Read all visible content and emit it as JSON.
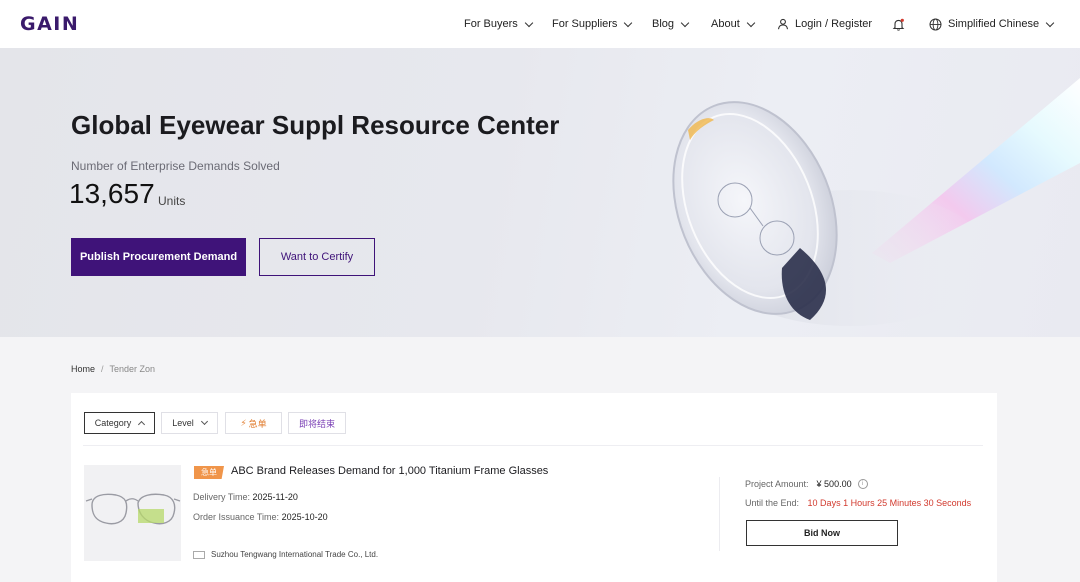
{
  "header": {
    "logo": "GAIN",
    "nav": {
      "for_buyers": "For Buyers",
      "for_suppliers": "For Suppliers",
      "blog": "Blog",
      "about": "About",
      "login": "Login / Register",
      "language": "Simplified Chinese"
    },
    "icons": [
      "chevron-down-icon",
      "user-icon",
      "bell-icon",
      "globe-icon"
    ],
    "brand_color": "#3a1a6b"
  },
  "hero": {
    "title": "Global Eyewear Suppl Resource Center",
    "subtitle": "Number of Enterprise Demands Solved",
    "count": "13,657",
    "unit": "Units",
    "primary_button": "Publish Procurement Demand",
    "secondary_button": "Want to Certify",
    "accent_color": "#3f1379"
  },
  "breadcrumb": {
    "home": "Home",
    "separator": "/",
    "current": "Tender Zon"
  },
  "filters": {
    "category": "Category",
    "level": "Level",
    "urgent": "急单",
    "ending_soon": "即将结束"
  },
  "listing": {
    "tag": "急单",
    "title": "ABC Brand Releases Demand for 1,000 Titanium Frame Glasses",
    "delivery_label": "Delivery Time:",
    "delivery_value": "2025-11-20",
    "issuance_label": "Order Issuance Time:",
    "issuance_value": "2025-10-20",
    "company": "Suzhou Tengwang International Trade Co., Ltd.",
    "amount_label": "Project Amount:",
    "amount_value": "¥ 500.00",
    "until_label": "Until the End:",
    "until_value": "10 Days 1 Hours 25 Minutes 30 Seconds",
    "bid_button": "Bid Now",
    "countdown_color": "#d23a2e",
    "tag_color": "#f0954a"
  }
}
